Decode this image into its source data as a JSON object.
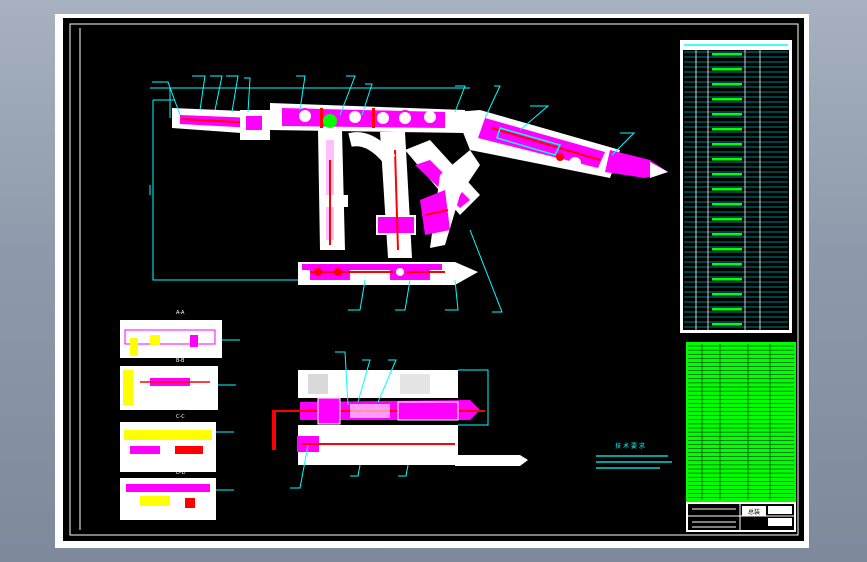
{
  "viewer": {
    "background_top": "#a7b1bf",
    "background_bottom": "#7e8a9b"
  },
  "drawing": {
    "sheet_color": "#ffffff",
    "canvas_color": "#000000",
    "line_colors": {
      "primary": "#ffffff",
      "callout": "#00ffff",
      "hydraulic": "#ff00ff",
      "centerline": "#ff0000",
      "dimension": "#ffff00",
      "parts_table": "#00ff00"
    },
    "views": [
      "main-elevation",
      "section-views",
      "plan-view"
    ],
    "technical_notes_heading": "技 术 要 求",
    "detail_labels": [
      "A-A",
      "B-B",
      "C-C",
      "D-D"
    ],
    "title_block_label": "总装"
  }
}
